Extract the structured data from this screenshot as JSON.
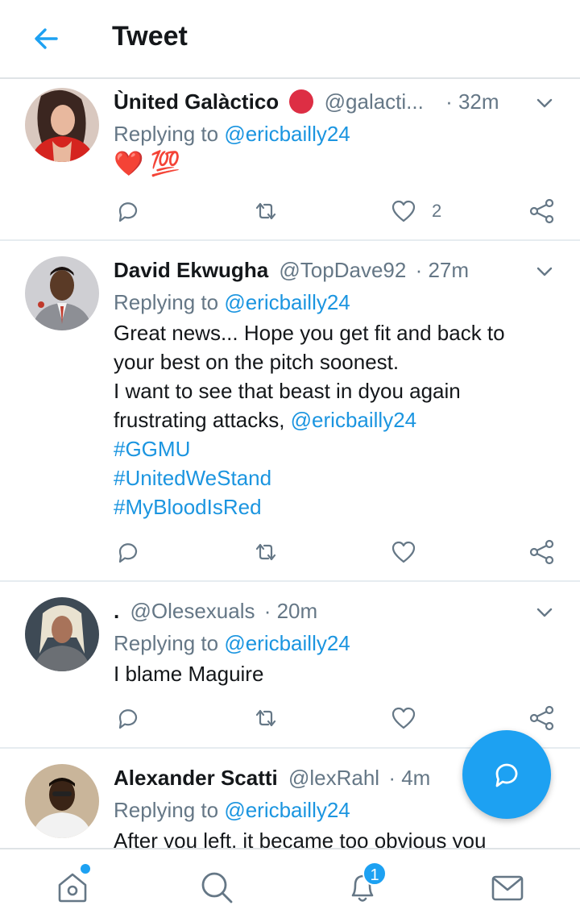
{
  "header": {
    "title": "Tweet"
  },
  "colors": {
    "accent": "#1da1f2",
    "link": "#1b95e0",
    "secondary_text": "#657786"
  },
  "tweets": [
    {
      "name": "Ùnited Galàctico",
      "handle": "@galacti...",
      "time": "· 32m",
      "replying_prefix": "Replying to ",
      "replying_to": "@ericbailly24",
      "body_emoji": "❤️ 💯",
      "like_count": "2"
    },
    {
      "name": "David Ekwugha",
      "handle": "@TopDave92",
      "time": "· 27m",
      "replying_prefix": "Replying to ",
      "replying_to": "@ericbailly24",
      "body_lines": [
        "Great news... Hope you get fit and back to",
        "your best on the pitch soonest.",
        "I want to see that beast in dyou again",
        "frustrating attacks, "
      ],
      "body_mention": "@ericbailly24",
      "hashtags": [
        "#GGMU",
        "#UnitedWeStand",
        "#MyBloodIsRed"
      ]
    },
    {
      "name": ".",
      "handle": "@Olesexuals",
      "time": "· 20m",
      "replying_prefix": "Replying to ",
      "replying_to": "@ericbailly24",
      "body": "I blame Maguire"
    },
    {
      "name": "Alexander Scatti",
      "handle": "@lexRahl",
      "time": "· 4m",
      "replying_prefix": "Replying to ",
      "replying_to": "@ericbailly24",
      "body": "After you left, it became too obvious you"
    }
  ],
  "bottom_nav": {
    "notification_count": "1"
  },
  "icons": [
    "back-arrow-icon",
    "chevron-down-icon",
    "reply-icon",
    "retweet-icon",
    "like-icon",
    "share-icon",
    "compose-reply-icon",
    "home-icon",
    "search-icon",
    "notifications-icon",
    "messages-icon"
  ]
}
